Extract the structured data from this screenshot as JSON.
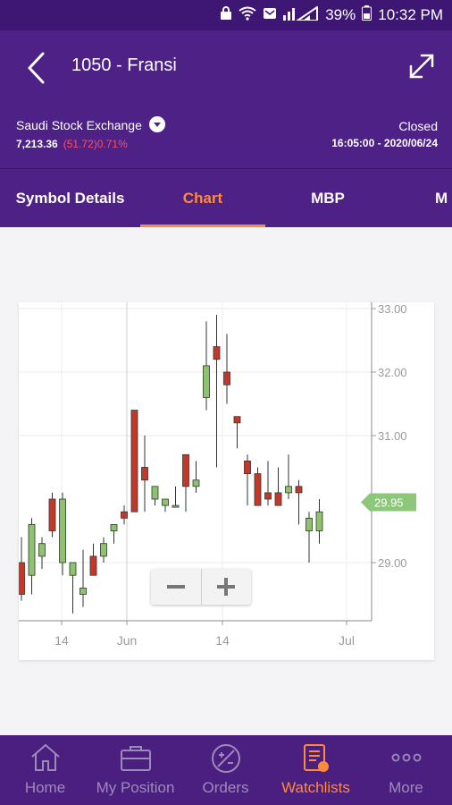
{
  "status_bar": {
    "battery_percent": "39%",
    "time": "10:32 PM"
  },
  "header": {
    "title": "1050 - Fransi"
  },
  "market": {
    "exchange": "Saudi Stock Exchange",
    "index_value": "7,213.36",
    "index_change": "(51.72)0.71%",
    "status": "Closed",
    "timestamp": "16:05:00 - 2020/06/24"
  },
  "tabs": [
    {
      "label": "Symbol Details"
    },
    {
      "label": "Chart"
    },
    {
      "label": "MBP"
    },
    {
      "label": "M"
    }
  ],
  "active_tab": "Chart",
  "chart_data": {
    "type": "candlestick",
    "y_ticks": [
      "33.00",
      "32.00",
      "31.00",
      "29.00"
    ],
    "x_ticks": [
      "14",
      "Jun",
      "14",
      "Jul"
    ],
    "ylim": [
      28.1,
      33.1
    ],
    "last_price": "29.95",
    "last_price_value": 29.95,
    "candles": [
      {
        "o": 29.0,
        "h": 29.4,
        "l": 28.4,
        "c": 28.5
      },
      {
        "o": 28.8,
        "h": 29.7,
        "l": 28.5,
        "c": 29.6
      },
      {
        "o": 29.1,
        "h": 29.4,
        "l": 28.9,
        "c": 29.3
      },
      {
        "o": 30.0,
        "h": 30.1,
        "l": 29.4,
        "c": 29.5
      },
      {
        "o": 29.0,
        "h": 30.1,
        "l": 28.8,
        "c": 30.0
      },
      {
        "o": 28.8,
        "h": 29.0,
        "l": 28.2,
        "c": 29.0
      },
      {
        "o": 28.5,
        "h": 29.2,
        "l": 28.3,
        "c": 28.6
      },
      {
        "o": 29.1,
        "h": 29.3,
        "l": 28.8,
        "c": 28.8
      },
      {
        "o": 29.1,
        "h": 29.4,
        "l": 29.0,
        "c": 29.3
      },
      {
        "o": 29.5,
        "h": 29.6,
        "l": 29.3,
        "c": 29.6
      },
      {
        "o": 29.8,
        "h": 29.9,
        "l": 29.6,
        "c": 29.7
      },
      {
        "o": 31.4,
        "h": 31.4,
        "l": 29.8,
        "c": 29.8
      },
      {
        "o": 30.5,
        "h": 31.0,
        "l": 29.8,
        "c": 30.3
      },
      {
        "o": 30.0,
        "h": 30.2,
        "l": 29.9,
        "c": 30.2
      },
      {
        "o": 29.9,
        "h": 30.0,
        "l": 29.8,
        "c": 30.0
      },
      {
        "o": 29.9,
        "h": 30.2,
        "l": 29.9,
        "c": 29.9
      },
      {
        "o": 30.7,
        "h": 30.7,
        "l": 29.8,
        "c": 30.2
      },
      {
        "o": 30.2,
        "h": 30.6,
        "l": 30.1,
        "c": 30.3
      },
      {
        "o": 31.6,
        "h": 32.8,
        "l": 31.4,
        "c": 32.1
      },
      {
        "o": 32.4,
        "h": 32.9,
        "l": 30.5,
        "c": 32.2
      },
      {
        "o": 32.0,
        "h": 32.6,
        "l": 31.5,
        "c": 31.8
      },
      {
        "o": 31.3,
        "h": 31.3,
        "l": 30.8,
        "c": 31.2
      },
      {
        "o": 30.6,
        "h": 30.7,
        "l": 29.9,
        "c": 30.4
      },
      {
        "o": 30.4,
        "h": 30.5,
        "l": 29.9,
        "c": 29.9
      },
      {
        "o": 30.1,
        "h": 30.6,
        "l": 29.9,
        "c": 30.0
      },
      {
        "o": 30.1,
        "h": 30.5,
        "l": 29.9,
        "c": 29.9
      },
      {
        "o": 30.1,
        "h": 30.7,
        "l": 30.0,
        "c": 30.2
      },
      {
        "o": 30.2,
        "h": 30.3,
        "l": 29.6,
        "c": 30.1
      },
      {
        "o": 29.5,
        "h": 29.8,
        "l": 29.0,
        "c": 29.7
      },
      {
        "o": 29.5,
        "h": 30.0,
        "l": 29.3,
        "c": 29.8
      }
    ]
  },
  "zoom": {
    "minus": "−",
    "plus": "+"
  },
  "bottom_nav": [
    {
      "label": "Home",
      "icon": "home-icon"
    },
    {
      "label": "My Position",
      "icon": "briefcase-icon"
    },
    {
      "label": "Orders",
      "icon": "orders-icon"
    },
    {
      "label": "Watchlists",
      "icon": "watchlist-icon"
    },
    {
      "label": "More",
      "icon": "more-icon"
    }
  ],
  "active_nav": "Watchlists",
  "colors": {
    "primary": "#4e2187",
    "accent": "#ff8a3d",
    "up": "#8dc26f",
    "down": "#c0392b"
  }
}
